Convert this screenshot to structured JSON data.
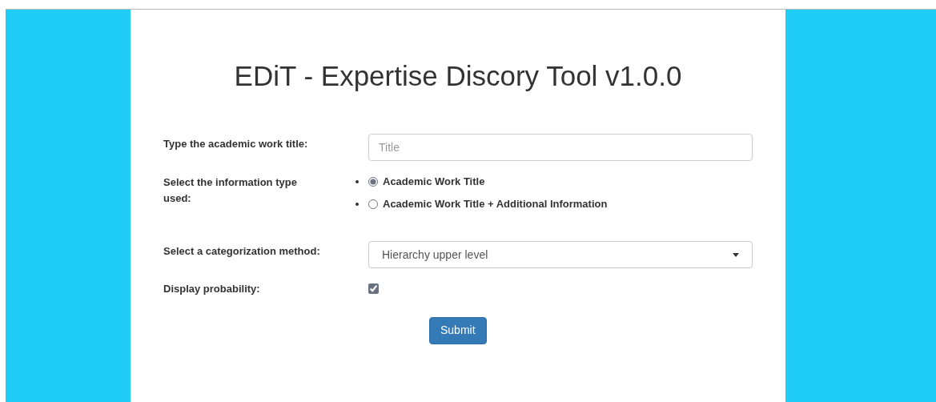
{
  "title": "EDiT - Expertise Discory Tool v1.0.0",
  "title_field": {
    "label": "Type the academic work title:",
    "placeholder": "Title"
  },
  "info_type": {
    "label": "Select the information type used:",
    "options": [
      {
        "label": "Academic Work Title",
        "selected": true
      },
      {
        "label": "Academic Work Title + Additional Information",
        "selected": false
      }
    ]
  },
  "method": {
    "label": "Select a categorization method:",
    "value": "Hierarchy upper level"
  },
  "probability": {
    "label": "Display probability:",
    "checked": true
  },
  "submit": "Submit"
}
